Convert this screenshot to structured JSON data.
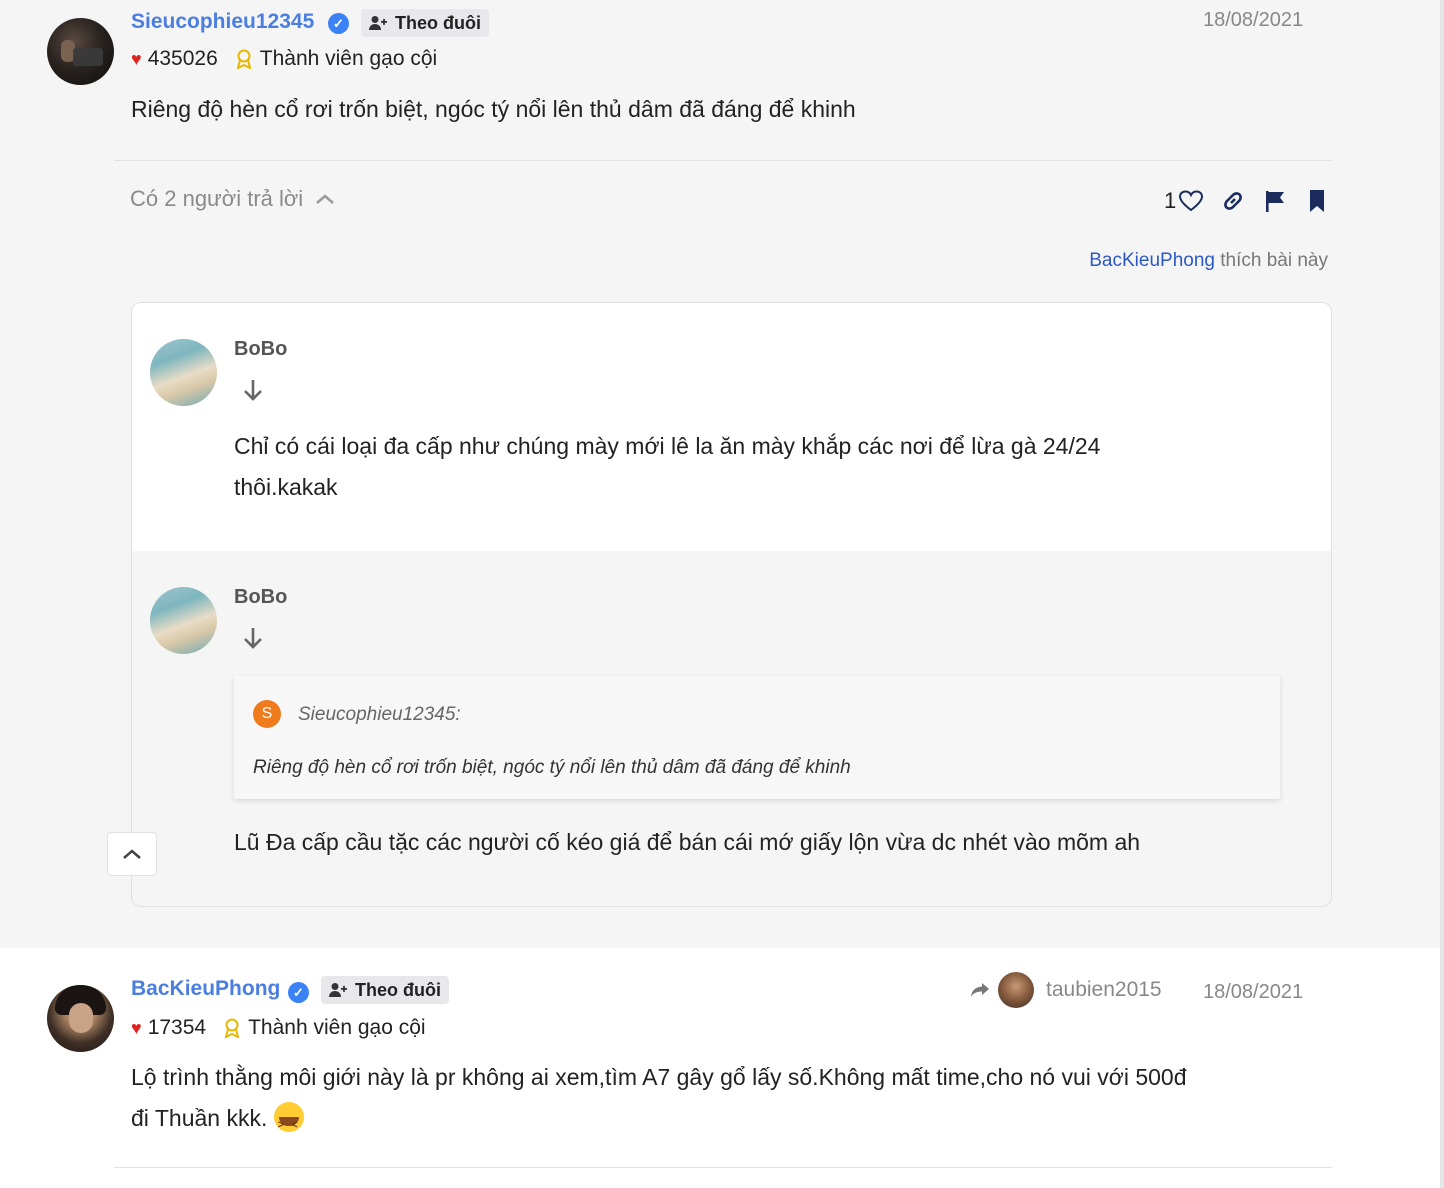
{
  "post1": {
    "username": "Sieucophieu12345",
    "follow_label": "Theo đuôi",
    "date": "18/08/2021",
    "likes": "435026",
    "rank": "Thành viên gạo cội",
    "content": "Riêng độ hèn cổ rơi trốn biệt, ngóc tý nổi lên thủ dâm đã đáng để khinh",
    "replies_label": "Có 2 người trả lời",
    "like_count": "1",
    "liked_by_name": "BacKieuPhong",
    "liked_by_suffix": " thích bài này"
  },
  "replies": [
    {
      "name": "BoBo",
      "text_line1": "Chỉ có cái loại đa cấp như chúng mày mới lê la ăn mày khắp các nơi để lừa gà 24/24",
      "text_line2": "thôi.kakak"
    },
    {
      "name": "BoBo",
      "quote_initial": "S",
      "quote_author": "Sieucophieu12345:",
      "quote_text": "Riêng độ hèn cổ rơi trốn biệt, ngóc tý nổi lên thủ dâm đã đáng để khinh",
      "text": "Lũ Đa cấp cầu tặc các người cố kéo giá để bán cái mớ giấy lộn vừa dc nhét vào mõm ah"
    }
  ],
  "post2": {
    "username": "BacKieuPhong",
    "follow_label": "Theo đuôi",
    "shared_from": "taubien2015",
    "date": "18/08/2021",
    "likes": "17354",
    "rank": "Thành viên gạo cội",
    "content_line1": "Lộ trình thằng môi giới này là pr không ai xem,tìm A7 gây gổ lấy số.Không mất time,cho nó vui với 500đ",
    "content_line2": "đi Thuần kkk."
  },
  "colors": {
    "username": "#4a7ee0",
    "verified": "#3b82f6",
    "heart": "#e02424",
    "liked_by_link": "#2b59c3",
    "quote_avatar": "#ef7b1d",
    "action_icons": "#1a2b5c"
  },
  "icons": [
    "verified-icon",
    "add-user-icon",
    "heart-icon",
    "medal-icon",
    "chevron-up-icon",
    "heart-outline-icon",
    "link-icon",
    "flag-icon",
    "bookmark-icon",
    "arrow-down-icon",
    "share-icon",
    "laughing-emoji-icon"
  ]
}
